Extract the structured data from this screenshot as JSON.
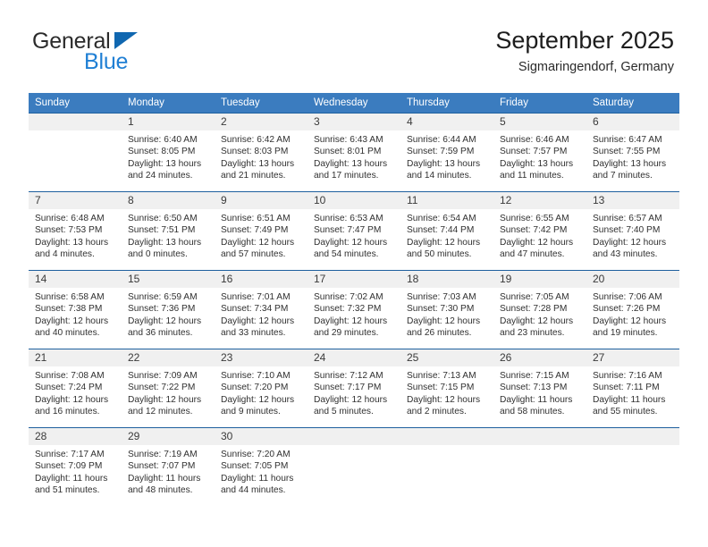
{
  "brand": {
    "line1": "General",
    "line2": "Blue",
    "triangle_color": "#1067b0",
    "blue_text_color": "#1f7fd4"
  },
  "header": {
    "month_title": "September 2025",
    "location": "Sigmaringendorf, Germany"
  },
  "theme": {
    "header_row_bg": "#3b7cbf",
    "cell_divider": "#1e5f9e",
    "daynum_band_bg": "#f0f0f0"
  },
  "weekday_headers": [
    "Sunday",
    "Monday",
    "Tuesday",
    "Wednesday",
    "Thursday",
    "Friday",
    "Saturday"
  ],
  "weeks": [
    [
      {
        "day": "",
        "lines": []
      },
      {
        "day": "1",
        "lines": [
          "Sunrise: 6:40 AM",
          "Sunset: 8:05 PM",
          "Daylight: 13 hours",
          "and 24 minutes."
        ]
      },
      {
        "day": "2",
        "lines": [
          "Sunrise: 6:42 AM",
          "Sunset: 8:03 PM",
          "Daylight: 13 hours",
          "and 21 minutes."
        ]
      },
      {
        "day": "3",
        "lines": [
          "Sunrise: 6:43 AM",
          "Sunset: 8:01 PM",
          "Daylight: 13 hours",
          "and 17 minutes."
        ]
      },
      {
        "day": "4",
        "lines": [
          "Sunrise: 6:44 AM",
          "Sunset: 7:59 PM",
          "Daylight: 13 hours",
          "and 14 minutes."
        ]
      },
      {
        "day": "5",
        "lines": [
          "Sunrise: 6:46 AM",
          "Sunset: 7:57 PM",
          "Daylight: 13 hours",
          "and 11 minutes."
        ]
      },
      {
        "day": "6",
        "lines": [
          "Sunrise: 6:47 AM",
          "Sunset: 7:55 PM",
          "Daylight: 13 hours",
          "and 7 minutes."
        ]
      }
    ],
    [
      {
        "day": "7",
        "lines": [
          "Sunrise: 6:48 AM",
          "Sunset: 7:53 PM",
          "Daylight: 13 hours",
          "and 4 minutes."
        ]
      },
      {
        "day": "8",
        "lines": [
          "Sunrise: 6:50 AM",
          "Sunset: 7:51 PM",
          "Daylight: 13 hours",
          "and 0 minutes."
        ]
      },
      {
        "day": "9",
        "lines": [
          "Sunrise: 6:51 AM",
          "Sunset: 7:49 PM",
          "Daylight: 12 hours",
          "and 57 minutes."
        ]
      },
      {
        "day": "10",
        "lines": [
          "Sunrise: 6:53 AM",
          "Sunset: 7:47 PM",
          "Daylight: 12 hours",
          "and 54 minutes."
        ]
      },
      {
        "day": "11",
        "lines": [
          "Sunrise: 6:54 AM",
          "Sunset: 7:44 PM",
          "Daylight: 12 hours",
          "and 50 minutes."
        ]
      },
      {
        "day": "12",
        "lines": [
          "Sunrise: 6:55 AM",
          "Sunset: 7:42 PM",
          "Daylight: 12 hours",
          "and 47 minutes."
        ]
      },
      {
        "day": "13",
        "lines": [
          "Sunrise: 6:57 AM",
          "Sunset: 7:40 PM",
          "Daylight: 12 hours",
          "and 43 minutes."
        ]
      }
    ],
    [
      {
        "day": "14",
        "lines": [
          "Sunrise: 6:58 AM",
          "Sunset: 7:38 PM",
          "Daylight: 12 hours",
          "and 40 minutes."
        ]
      },
      {
        "day": "15",
        "lines": [
          "Sunrise: 6:59 AM",
          "Sunset: 7:36 PM",
          "Daylight: 12 hours",
          "and 36 minutes."
        ]
      },
      {
        "day": "16",
        "lines": [
          "Sunrise: 7:01 AM",
          "Sunset: 7:34 PM",
          "Daylight: 12 hours",
          "and 33 minutes."
        ]
      },
      {
        "day": "17",
        "lines": [
          "Sunrise: 7:02 AM",
          "Sunset: 7:32 PM",
          "Daylight: 12 hours",
          "and 29 minutes."
        ]
      },
      {
        "day": "18",
        "lines": [
          "Sunrise: 7:03 AM",
          "Sunset: 7:30 PM",
          "Daylight: 12 hours",
          "and 26 minutes."
        ]
      },
      {
        "day": "19",
        "lines": [
          "Sunrise: 7:05 AM",
          "Sunset: 7:28 PM",
          "Daylight: 12 hours",
          "and 23 minutes."
        ]
      },
      {
        "day": "20",
        "lines": [
          "Sunrise: 7:06 AM",
          "Sunset: 7:26 PM",
          "Daylight: 12 hours",
          "and 19 minutes."
        ]
      }
    ],
    [
      {
        "day": "21",
        "lines": [
          "Sunrise: 7:08 AM",
          "Sunset: 7:24 PM",
          "Daylight: 12 hours",
          "and 16 minutes."
        ]
      },
      {
        "day": "22",
        "lines": [
          "Sunrise: 7:09 AM",
          "Sunset: 7:22 PM",
          "Daylight: 12 hours",
          "and 12 minutes."
        ]
      },
      {
        "day": "23",
        "lines": [
          "Sunrise: 7:10 AM",
          "Sunset: 7:20 PM",
          "Daylight: 12 hours",
          "and 9 minutes."
        ]
      },
      {
        "day": "24",
        "lines": [
          "Sunrise: 7:12 AM",
          "Sunset: 7:17 PM",
          "Daylight: 12 hours",
          "and 5 minutes."
        ]
      },
      {
        "day": "25",
        "lines": [
          "Sunrise: 7:13 AM",
          "Sunset: 7:15 PM",
          "Daylight: 12 hours",
          "and 2 minutes."
        ]
      },
      {
        "day": "26",
        "lines": [
          "Sunrise: 7:15 AM",
          "Sunset: 7:13 PM",
          "Daylight: 11 hours",
          "and 58 minutes."
        ]
      },
      {
        "day": "27",
        "lines": [
          "Sunrise: 7:16 AM",
          "Sunset: 7:11 PM",
          "Daylight: 11 hours",
          "and 55 minutes."
        ]
      }
    ],
    [
      {
        "day": "28",
        "lines": [
          "Sunrise: 7:17 AM",
          "Sunset: 7:09 PM",
          "Daylight: 11 hours",
          "and 51 minutes."
        ]
      },
      {
        "day": "29",
        "lines": [
          "Sunrise: 7:19 AM",
          "Sunset: 7:07 PM",
          "Daylight: 11 hours",
          "and 48 minutes."
        ]
      },
      {
        "day": "30",
        "lines": [
          "Sunrise: 7:20 AM",
          "Sunset: 7:05 PM",
          "Daylight: 11 hours",
          "and 44 minutes."
        ]
      },
      {
        "day": "",
        "lines": []
      },
      {
        "day": "",
        "lines": []
      },
      {
        "day": "",
        "lines": []
      },
      {
        "day": "",
        "lines": []
      }
    ]
  ]
}
